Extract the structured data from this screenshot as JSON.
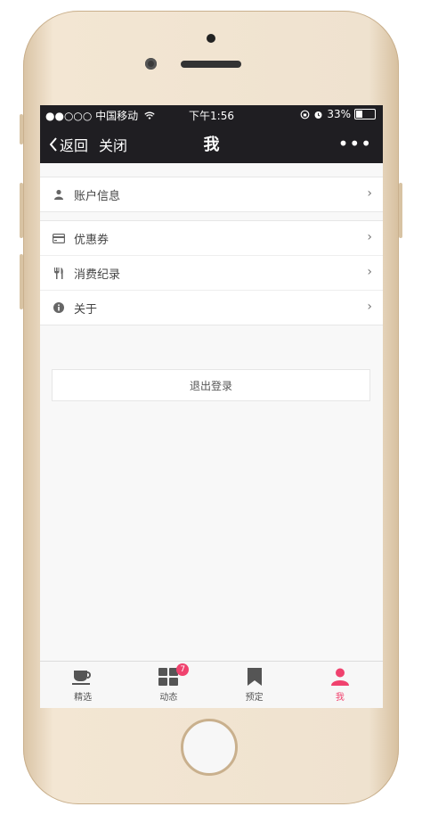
{
  "statusbar": {
    "carrier": "●●○○○ 中国移动",
    "time": "下午1:56",
    "battery_text": "33%",
    "battery_level": 0.33
  },
  "navbar": {
    "back": "返回",
    "close": "关闭",
    "title": "我",
    "more": "•••"
  },
  "groups": [
    {
      "items": [
        {
          "label": "账户信息",
          "icon": "user-icon"
        }
      ]
    },
    {
      "items": [
        {
          "label": "优惠券",
          "icon": "card-icon"
        },
        {
          "label": "消费纪录",
          "icon": "utensils-icon"
        },
        {
          "label": "关于",
          "icon": "info-icon"
        }
      ]
    }
  ],
  "logout": "退出登录",
  "tabbar": {
    "items": [
      {
        "label": "精选",
        "icon": "cup-icon",
        "active": false
      },
      {
        "label": "动态",
        "icon": "grid-icon",
        "badge": "7",
        "active": false
      },
      {
        "label": "预定",
        "icon": "bookmark-icon",
        "active": false
      },
      {
        "label": "我",
        "icon": "person-icon",
        "active": true
      }
    ]
  },
  "colors": {
    "accent": "#f0426e",
    "nav_bg": "#1f1e22",
    "page_bg": "#f8f8f8"
  }
}
